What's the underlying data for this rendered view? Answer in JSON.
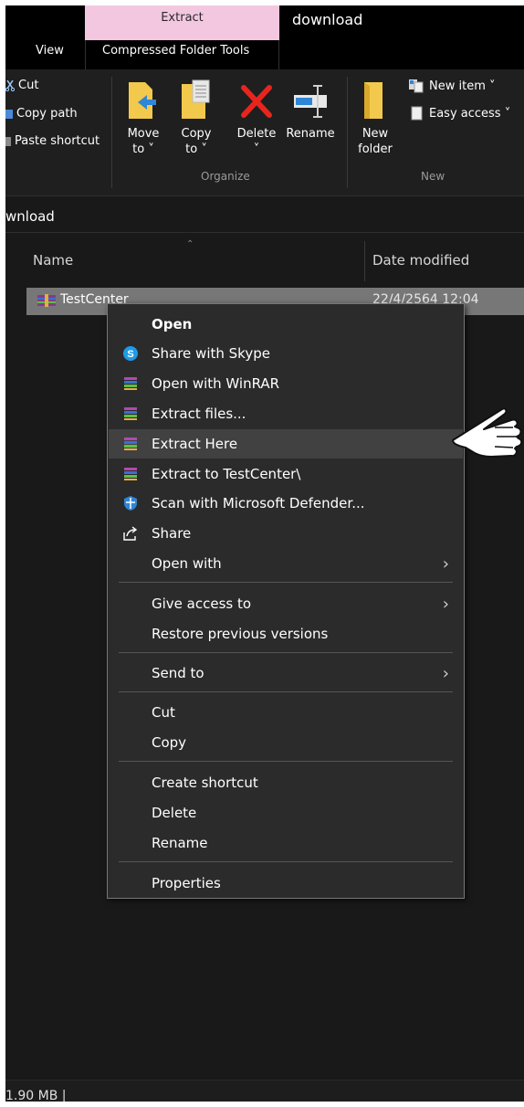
{
  "window": {
    "title": "download"
  },
  "tabs": {
    "extract": "Extract",
    "view": "View",
    "compressed_tools": "Compressed Folder Tools"
  },
  "ribbon": {
    "clipboard": {
      "cut": "Cut",
      "copy_path": "Copy path",
      "paste_shortcut": "Paste shortcut"
    },
    "organize": {
      "move_to_1": "Move",
      "move_to_2": "to ˅",
      "copy_to_1": "Copy",
      "copy_to_2": "to ˅",
      "delete": "Delete",
      "delete_caret": "˅",
      "rename": "Rename",
      "group_label": "Organize"
    },
    "new": {
      "new_folder_1": "New",
      "new_folder_2": "folder",
      "new_item": "New item ˅",
      "easy_access": "Easy access ˅",
      "group_label": "New"
    }
  },
  "address": {
    "path": "wnload"
  },
  "file_list": {
    "columns": {
      "name": "Name",
      "date_modified": "Date modified"
    },
    "rows": [
      {
        "name": "TestCenter",
        "date": "22/4/2564 12:04",
        "icon": "winrar-archive-icon"
      }
    ]
  },
  "context_menu": {
    "items": [
      {
        "label": "Open",
        "icon": ""
      },
      {
        "label": "Share with Skype",
        "icon": "skype-icon"
      },
      {
        "label": "Open with WinRAR",
        "icon": "winrar-icon"
      },
      {
        "label": "Extract files...",
        "icon": "winrar-icon"
      },
      {
        "label": "Extract Here",
        "icon": "winrar-icon"
      },
      {
        "label": "Extract to TestCenter\\",
        "icon": "winrar-icon"
      },
      {
        "label": "Scan with Microsoft Defender...",
        "icon": "defender-icon"
      },
      {
        "label": "Share",
        "icon": "share-icon"
      },
      {
        "label": "Open with",
        "icon": ""
      },
      {
        "label": "Give access to",
        "icon": ""
      },
      {
        "label": "Restore previous versions",
        "icon": ""
      },
      {
        "label": "Send to",
        "icon": ""
      },
      {
        "label": "Cut",
        "icon": ""
      },
      {
        "label": "Copy",
        "icon": ""
      },
      {
        "label": "Create shortcut",
        "icon": ""
      },
      {
        "label": "Delete",
        "icon": ""
      },
      {
        "label": "Rename",
        "icon": ""
      },
      {
        "label": "Properties",
        "icon": ""
      }
    ],
    "highlighted": "Extract Here",
    "submenu_arrow": "›"
  },
  "status": {
    "text": "1.90 MB  |"
  },
  "colors": {
    "extract_tab": "#f3c7df",
    "background": "#191919",
    "menu_bg": "#2b2b2b",
    "menu_highlight": "#414141",
    "selected_row": "#777777"
  }
}
